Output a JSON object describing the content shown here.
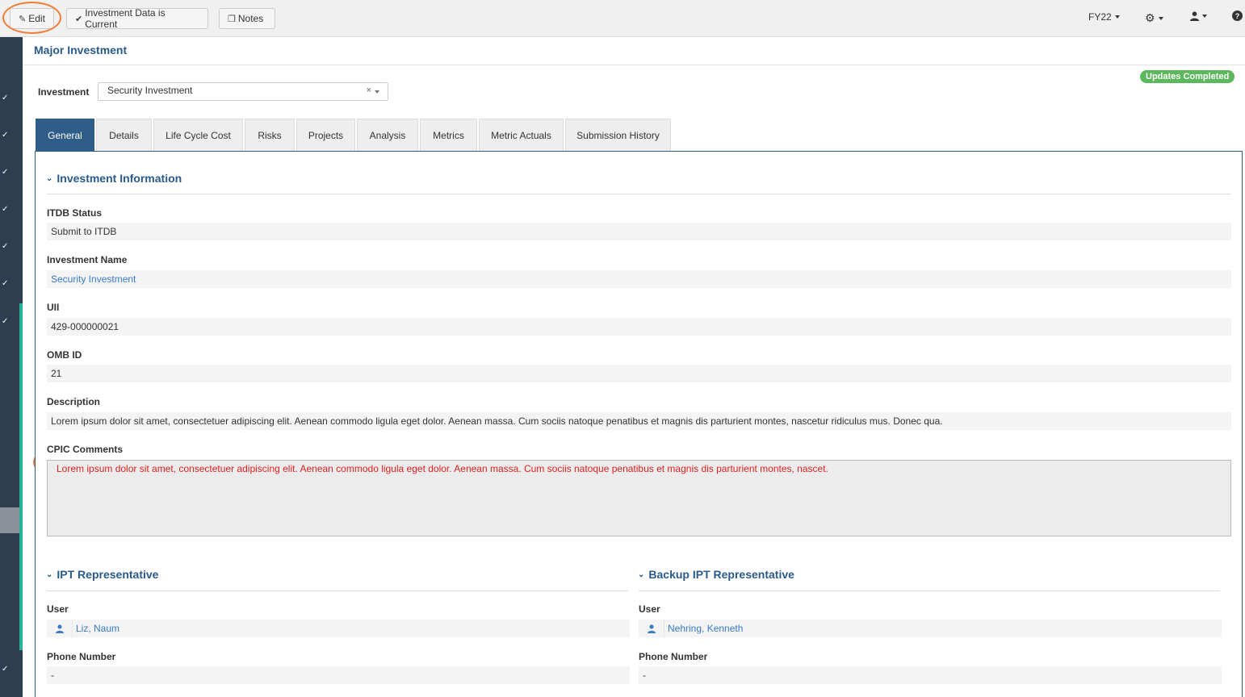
{
  "toolbar": {
    "edit_label": "Edit",
    "current_label": "Investment Data is Current",
    "notes_label": "Notes",
    "fiscal_year": "FY22"
  },
  "icons": {
    "edit": "pencil-square-icon",
    "current": "check-circle-icon",
    "notes": "copy-icon",
    "settings": "gears-icon",
    "user": "user-icon",
    "help": "question-circle-icon",
    "sidebar": "chevron-icon"
  },
  "colors": {
    "primary": "#2f5d8a",
    "accent_sidebar": "#2bb39a",
    "badge": "#5cb85c",
    "annotation": "#ef7d32",
    "comment_text": "#e02020",
    "link": "#3a7bc8"
  },
  "page": {
    "title": "Major Investment",
    "status_badge": "Updates Completed"
  },
  "investment_select": {
    "label": "Investment",
    "value": "Security Investment",
    "clear": "×"
  },
  "tabs": [
    {
      "label": "General",
      "active": true
    },
    {
      "label": "Details"
    },
    {
      "label": "Life Cycle Cost"
    },
    {
      "label": "Risks"
    },
    {
      "label": "Projects"
    },
    {
      "label": "Analysis"
    },
    {
      "label": "Metrics"
    },
    {
      "label": "Metric Actuals"
    },
    {
      "label": "Submission History"
    }
  ],
  "investment_info": {
    "heading": "Investment Information",
    "itdb_status_label": "ITDB Status",
    "itdb_status": "Submit to ITDB",
    "name_label": "Investment Name",
    "name": "Security Investment",
    "uii_label": "UII",
    "uii": "429-000000021",
    "omb_label": "OMB ID",
    "omb": "21",
    "description_label": "Description",
    "description": "Lorem ipsum dolor sit amet, consectetuer adipiscing elit. Aenean commodo ligula eget dolor. Aenean massa. Cum sociis natoque penatibus et magnis dis parturient montes, nascetur ridiculus mus. Donec qua.",
    "cpic_label": "CPIC Comments",
    "cpic": "Lorem ipsum dolor sit amet, consectetuer adipiscing elit. Aenean commodo ligula eget dolor. Aenean massa. Cum sociis natoque penatibus et magnis dis parturient montes, nascet."
  },
  "ipt": {
    "heading": "IPT Representative",
    "user_label": "User",
    "user": "Liz, Naum",
    "phone_label": "Phone Number",
    "phone": "-"
  },
  "backup_ipt": {
    "heading": "Backup IPT Representative",
    "user_label": "User",
    "user": "Nehring, Kenneth",
    "phone_label": "Phone Number",
    "phone": "-"
  }
}
